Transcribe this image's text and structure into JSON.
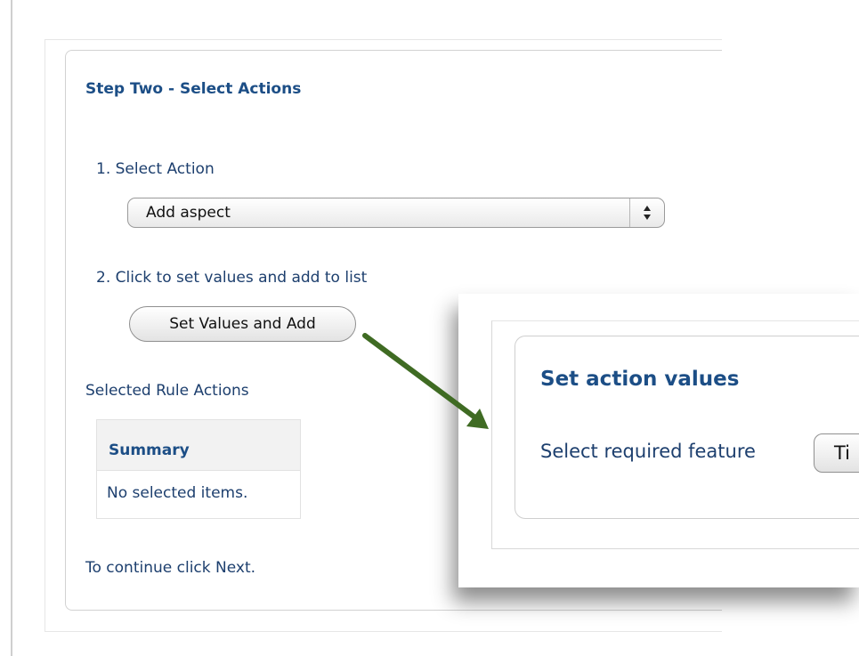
{
  "step": {
    "title": "Step Two - Select Actions",
    "select_action_label": "1.  Select Action",
    "action_select_value": "Add aspect",
    "set_values_label": "2.  Click to set values and add to list",
    "set_values_button": "Set Values and Add",
    "selected_rule_actions_label": "Selected Rule Actions",
    "summary": {
      "header": "Summary",
      "rows": [
        "No selected items."
      ]
    },
    "continue_text": "To continue click Next."
  },
  "popup": {
    "title": "Set action values",
    "required_feature_label": "Select required feature",
    "feature_button_text": "Ti"
  },
  "icons": {
    "select_arrows": "updown-arrows-icon",
    "callout_arrow": "arrow-icon"
  },
  "colors": {
    "heading": "#1c4e86",
    "text": "#1d3f6e",
    "arrow": "#3f6b23"
  }
}
